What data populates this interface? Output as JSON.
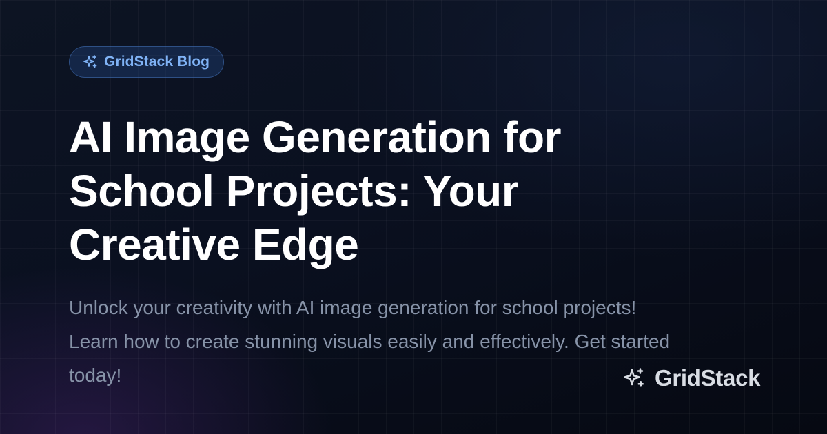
{
  "badge": {
    "icon": "sparkles-icon",
    "label": "GridStack Blog",
    "color": "#7fb2f5"
  },
  "article": {
    "title": "AI Image Generation for School Projects: Your Creative Edge",
    "description": "Unlock your creativity with AI image generation for school projects! Learn how to create stunning visuals easily and effectively. Get started today!"
  },
  "brand": {
    "icon": "sparkles-icon",
    "name": "GridStack"
  },
  "colors": {
    "background": "#0a1020",
    "title": "#ffffff",
    "description": "#8793a8",
    "brand": "#d9dde4"
  }
}
